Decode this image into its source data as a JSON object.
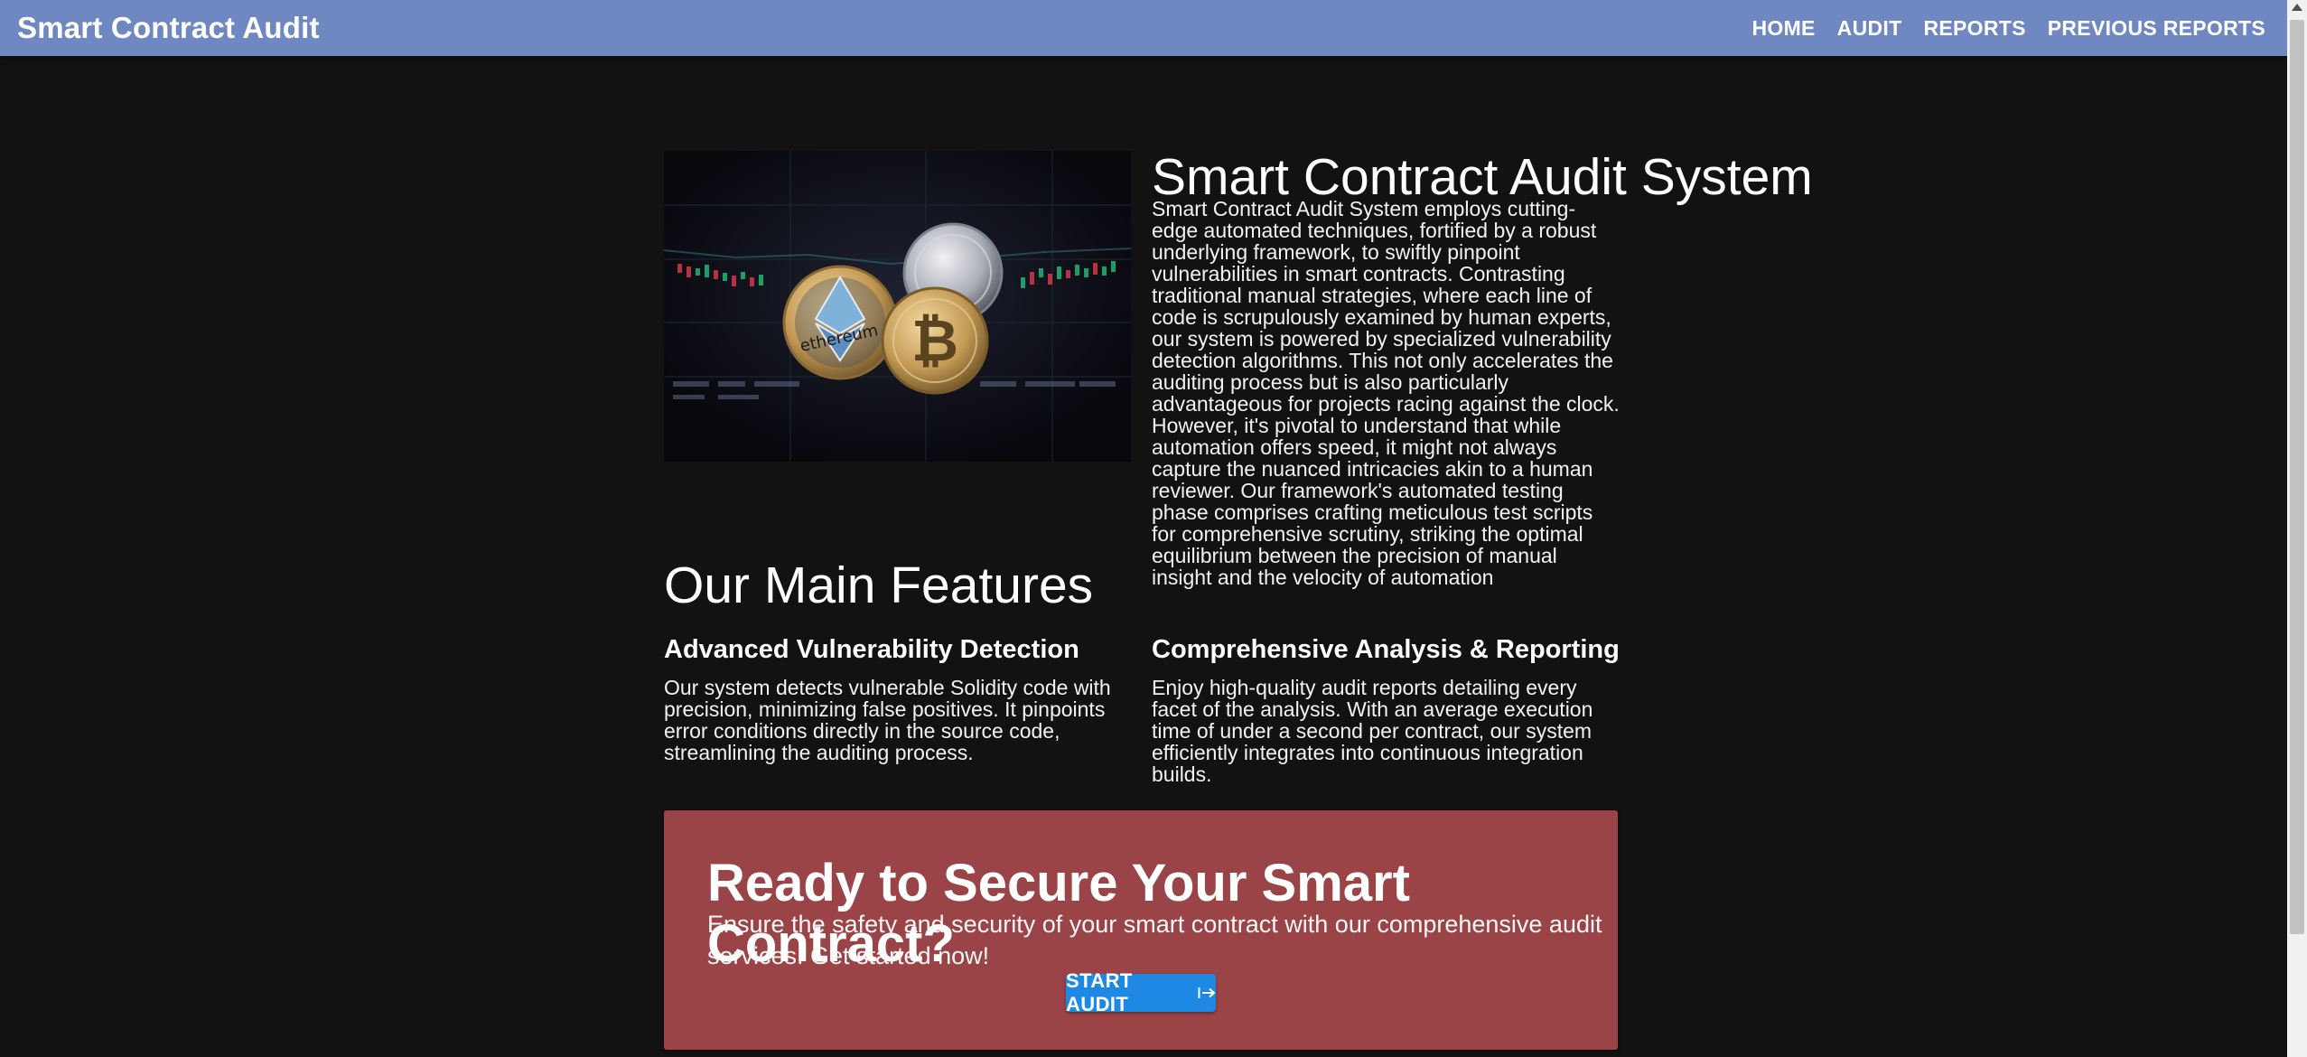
{
  "app": {
    "brand": "Smart Contract Audit",
    "nav": {
      "home": "HOME",
      "audit": "AUDIT",
      "reports": "REPORTS",
      "previous_reports": "PREVIOUS REPORTS"
    }
  },
  "hero": {
    "title": "Smart Contract Audit System",
    "text": "Smart Contract Audit System employs cutting-edge automated techniques, fortified by a robust underlying framework, to swiftly pinpoint vulnerabilities in smart contracts. Contrasting traditional manual strategies, where each line of code is scrupulously examined by human experts, our system is powered by specialized vulnerability detection algorithms. This not only accelerates the auditing process but is also particularly advantageous for projects racing against the clock. However, it's pivotal to understand that while automation offers speed, it might not always capture the nuanced intricacies akin to a human reviewer. Our framework's automated testing phase comprises crafting meticulous test scripts for comprehensive scrutiny, striking the optimal equilibrium between the precision of manual insight and the velocity of automation",
    "image_icon": "crypto-coins-image",
    "coin_labels": {
      "ethereum": "ethereum"
    }
  },
  "features": {
    "title": "Our Main Features",
    "items": [
      {
        "title": "Advanced Vulnerability Detection",
        "text": "Our system detects vulnerable Solidity code with precision, minimizing false positives. It pinpoints error conditions directly in the source code, streamlining the auditing process."
      },
      {
        "title": "Comprehensive Analysis & Reporting",
        "text": "Enjoy high-quality audit reports detailing every facet of the analysis. With an average execution time of under a second per contract, our system efficiently integrates into continuous integration builds."
      }
    ]
  },
  "cta": {
    "title": "Ready to Secure Your Smart Contract?",
    "text": "Ensure the safety and security of your smart contract with our comprehensive audit services. Get started now!",
    "button_label": "START AUDIT",
    "button_icon": "arrow-right-to-bar-icon"
  },
  "colors": {
    "appbar": "#6f88c2",
    "background": "#121212",
    "cta_background": "#9a4448",
    "button": "#1e88e5"
  }
}
